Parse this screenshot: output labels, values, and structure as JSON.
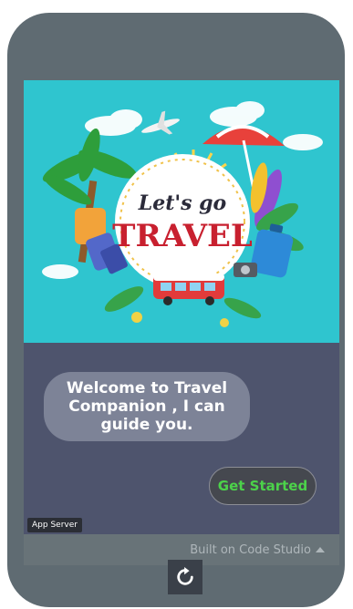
{
  "banner": {
    "title_script": "Let's go",
    "title_main": "TRAVEL"
  },
  "chat": {
    "welcome_message": "Welcome to Travel Companion , I can guide you."
  },
  "actions": {
    "get_started_label": "Get Started",
    "refresh_icon": "refresh-icon"
  },
  "badge": {
    "app_server_label": "App Server"
  },
  "footer": {
    "built_on_label": "Built on Code Studio"
  },
  "colors": {
    "phone_frame": "#5f6b72",
    "chat_background": "#4e546d",
    "bubble": "#7d8397",
    "accent_green": "#4cd24a",
    "banner_sky": "#2fc5cf"
  }
}
